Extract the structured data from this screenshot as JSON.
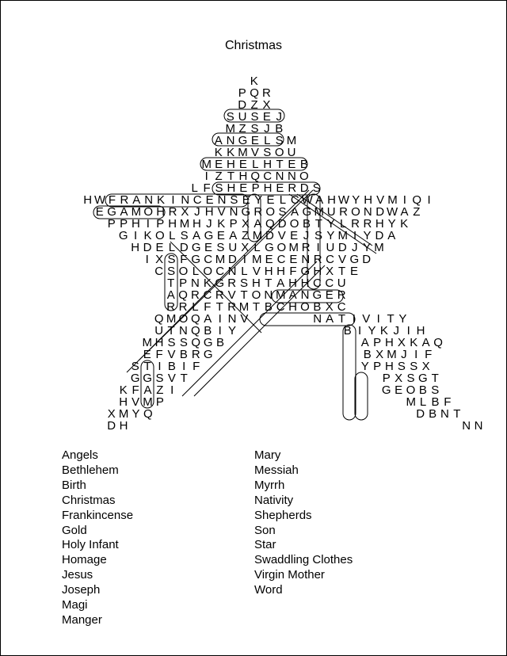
{
  "title": "Christmas",
  "grid_rows": [
    {
      "indent": 0,
      "letters": "K"
    },
    {
      "indent": 0,
      "letters": "PQR"
    },
    {
      "indent": 0,
      "letters": "DZX"
    },
    {
      "indent": 0,
      "letters": "SUSEJ"
    },
    {
      "indent": 0,
      "letters": "MZSJB"
    },
    {
      "indent": 0,
      "letters": "ANGELSM"
    },
    {
      "indent": 0,
      "letters": "KKMVSOU"
    },
    {
      "indent": 0,
      "letters": "MEHELHTEB"
    },
    {
      "indent": 0,
      "letters": "IZTHQCNNO"
    },
    {
      "indent": 0,
      "letters": "LFSHEPHERDS"
    },
    {
      "indent": 0,
      "letters": "HWFRANKINCENSEYELCWAHWYHVMIQI"
    },
    {
      "indent": 0,
      "letters": "EGAMOHRXJHVNGROSAGMURONDWAZ"
    },
    {
      "indent": 0,
      "letters": "PPHIPHMHJKPXAQDOBTYLRRHYK"
    },
    {
      "indent": 0,
      "letters": "GIKOLSAGEAZMDVEJSYMIYDA"
    },
    {
      "indent": 0,
      "letters": "HDELDGESUXLGOMRIUDJYM"
    },
    {
      "indent": 0,
      "letters": "IXSFGCMDIMECENRCVGD"
    },
    {
      "indent": 0,
      "letters": "CSOLOCNLVHHFGHXTE"
    },
    {
      "indent": 0,
      "letters": "TPNKGRSHTAHHCCU"
    },
    {
      "indent": 0,
      "letters": "AQRCRVTONMANGER"
    },
    {
      "indent": 0,
      "letters": "RRLFTRMTBCHOBXC"
    },
    {
      "indent": 0,
      "letters": "QMOQAINV NATIVITY"
    },
    {
      "indent": 0,
      "letters": "UTNQBIY BIYKJIH"
    },
    {
      "indent": 0,
      "letters": "MHSSQGB APHXKAQ"
    },
    {
      "indent": 0,
      "letters": "EFVBRG BXMJIF"
    },
    {
      "indent": 0,
      "letters": "STIBIF YPHSSX"
    },
    {
      "indent": 0,
      "letters": "GGSVT PXSGT"
    },
    {
      "indent": 0,
      "letters": "KFAZI GEOBS"
    },
    {
      "indent": 0,
      "letters": "HVMP MLBF"
    },
    {
      "indent": 0,
      "letters": "XMYQ DBNT"
    },
    {
      "indent": 0,
      "letters": "DH NN"
    }
  ],
  "word_list": {
    "left": [
      "Angels",
      "Bethlehem",
      "Birth",
      "Christmas",
      "Frankincense",
      "Gold",
      "Holy Infant",
      "Homage",
      "Jesus",
      "Joseph",
      "Magi",
      "Manger"
    ],
    "right": [
      "Mary",
      "Messiah",
      "Myrrh",
      "Nativity",
      "Shepherds",
      "Son",
      "Star",
      "Swaddling Clothes",
      "Virgin Mother",
      "Word"
    ]
  }
}
